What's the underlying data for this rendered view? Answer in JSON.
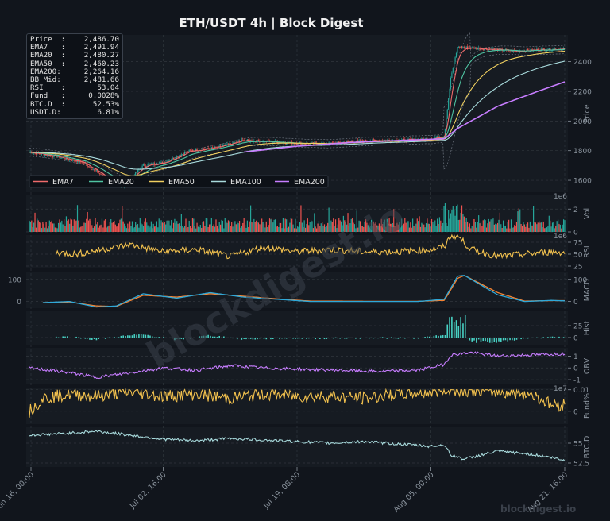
{
  "title": "ETH/USDT  4h  |  Block Digest",
  "watermark_center": "blockdigest.io",
  "watermark_corner": "blockdigest.io",
  "info_box": [
    {
      "label": "Price  :",
      "value": "2,486.70"
    },
    {
      "label": "EMA7   :",
      "value": "2,491.94"
    },
    {
      "label": "EMA20  :",
      "value": "2,480.27"
    },
    {
      "label": "EMA50  :",
      "value": "2,460.23"
    },
    {
      "label": "EMA200:",
      "value": "2,264.16"
    },
    {
      "label": "BB Mid:",
      "value": "2,481.66"
    },
    {
      "label": "RSI    :",
      "value": "53.04"
    },
    {
      "label": "Fund   :",
      "value": "0.0028%"
    },
    {
      "label": "BTC.D  :",
      "value": "52.53%"
    },
    {
      "label": "USDT.D:",
      "value": "6.81%"
    }
  ],
  "colors": {
    "background": "#11151c",
    "candle_up": "#26a69a",
    "candle_down": "#ef5350",
    "ema7": "#ef6b6b",
    "ema20": "#4fc3a1",
    "ema50": "#f0d060",
    "ema100": "#a8dadc",
    "ema200": "#c77dff",
    "rsi": "#f2c14e",
    "macd": "#2fa8d8",
    "signal": "#f58231",
    "hist": "#48d1c4",
    "obv": "#c77dff",
    "funding": "#f2c14e",
    "btcd": "#a8dadc"
  },
  "chart_data": {
    "type": "line",
    "x_ticks": [
      "Jun 16, 00:00",
      "Jul 02, 16:00",
      "Jul 19, 08:00",
      "Aug 05, 00:00",
      "Aug 21, 16:00"
    ],
    "panels": [
      {
        "name": "price",
        "ylabel": "Price",
        "exponent_label": "1e6",
        "ylim": [
          1520,
          2580
        ],
        "yticks": [
          1600,
          1800,
          2000,
          2200,
          2400
        ],
        "legend": [
          "EMA7",
          "EMA20",
          "EMA50",
          "EMA100",
          "EMA200"
        ],
        "legend_position": "lower-left",
        "close_anchors": [
          [
            0,
            1790
          ],
          [
            4,
            1760
          ],
          [
            8,
            1720
          ],
          [
            12,
            1600
          ],
          [
            14,
            1560
          ],
          [
            17,
            1700
          ],
          [
            20,
            1720
          ],
          [
            24,
            1800
          ],
          [
            28,
            1820
          ],
          [
            32,
            1870
          ],
          [
            36,
            1860
          ],
          [
            40,
            1850
          ],
          [
            44,
            1845
          ],
          [
            48,
            1860
          ],
          [
            52,
            1870
          ],
          [
            56,
            1870
          ],
          [
            60,
            1880
          ],
          [
            62,
            1900
          ],
          [
            63,
            2300
          ],
          [
            64,
            2500
          ],
          [
            67,
            2490
          ],
          [
            70,
            2480
          ],
          [
            73,
            2470
          ],
          [
            76,
            2480
          ],
          [
            80,
            2487
          ]
        ],
        "ema200_anchors": [
          [
            32,
            1790
          ],
          [
            40,
            1830
          ],
          [
            48,
            1855
          ],
          [
            56,
            1870
          ],
          [
            62,
            1880
          ],
          [
            64,
            1950
          ],
          [
            70,
            2100
          ],
          [
            76,
            2200
          ],
          [
            80,
            2264
          ]
        ]
      },
      {
        "name": "volume",
        "ylabel": "Vol",
        "exponent_label": "1e6",
        "ylim": [
          0,
          3.2
        ],
        "yticks": [
          0,
          2
        ]
      },
      {
        "name": "rsi",
        "ylabel": "RSI",
        "ylim": [
          20,
          90
        ],
        "yticks": [
          25,
          50,
          75
        ],
        "anchors": [
          [
            0,
            35
          ],
          [
            3,
            55
          ],
          [
            7,
            50
          ],
          [
            11,
            60
          ],
          [
            15,
            70
          ],
          [
            20,
            55
          ],
          [
            25,
            60
          ],
          [
            30,
            45
          ],
          [
            35,
            65
          ],
          [
            40,
            55
          ],
          [
            45,
            60
          ],
          [
            50,
            55
          ],
          [
            55,
            55
          ],
          [
            60,
            60
          ],
          [
            62,
            65
          ],
          [
            63,
            90
          ],
          [
            64,
            88
          ],
          [
            66,
            60
          ],
          [
            70,
            45
          ],
          [
            74,
            50
          ],
          [
            78,
            55
          ],
          [
            80,
            53
          ]
        ]
      },
      {
        "name": "macd",
        "ylabel": "MACD",
        "ylim": [
          -30,
          135
        ],
        "yticks": [
          0,
          100
        ],
        "macd_anchors": [
          [
            2,
            -5
          ],
          [
            6,
            0
          ],
          [
            10,
            -25
          ],
          [
            13,
            -20
          ],
          [
            17,
            35
          ],
          [
            22,
            15
          ],
          [
            27,
            40
          ],
          [
            32,
            20
          ],
          [
            37,
            10
          ],
          [
            42,
            0
          ],
          [
            50,
            0
          ],
          [
            58,
            0
          ],
          [
            62,
            10
          ],
          [
            64,
            115
          ],
          [
            65,
            118
          ],
          [
            70,
            30
          ],
          [
            74,
            0
          ],
          [
            78,
            5
          ],
          [
            80,
            3
          ]
        ],
        "signal_anchors": [
          [
            2,
            -5
          ],
          [
            6,
            -2
          ],
          [
            10,
            -20
          ],
          [
            13,
            -22
          ],
          [
            17,
            28
          ],
          [
            22,
            20
          ],
          [
            27,
            35
          ],
          [
            32,
            24
          ],
          [
            37,
            12
          ],
          [
            42,
            2
          ],
          [
            50,
            1
          ],
          [
            58,
            1
          ],
          [
            62,
            5
          ],
          [
            64,
            105
          ],
          [
            65,
            118
          ],
          [
            70,
            40
          ],
          [
            74,
            2
          ],
          [
            78,
            4
          ],
          [
            80,
            4
          ]
        ]
      },
      {
        "name": "hist",
        "ylabel": "Hist",
        "ylim": [
          -15,
          55
        ],
        "yticks": [
          0,
          25
        ]
      },
      {
        "name": "obv",
        "ylabel": "OBV",
        "exponent_label": "1e7",
        "ylim": [
          -1.4,
          1.7
        ],
        "yticks": [
          -1,
          0,
          1
        ],
        "anchors": [
          [
            0,
            0
          ],
          [
            6,
            -0.4
          ],
          [
            10,
            -0.8
          ],
          [
            14,
            -0.5
          ],
          [
            20,
            0
          ],
          [
            25,
            -0.2
          ],
          [
            30,
            0.2
          ],
          [
            35,
            0
          ],
          [
            40,
            -0.1
          ],
          [
            46,
            -0.2
          ],
          [
            52,
            -0.3
          ],
          [
            58,
            -0.2
          ],
          [
            62,
            0.3
          ],
          [
            63,
            1.1
          ],
          [
            66,
            1.3
          ],
          [
            70,
            1.0
          ],
          [
            75,
            1.1
          ],
          [
            80,
            1.2
          ]
        ]
      },
      {
        "name": "funding",
        "ylabel": "Fund%",
        "ylim": [
          -0.006,
          0.011
        ],
        "yticks": [
          0.0,
          0.01
        ],
        "anchors": [
          [
            0,
            0.0
          ],
          [
            2,
            0.006
          ],
          [
            6,
            0.008
          ],
          [
            10,
            0.007
          ],
          [
            15,
            0.009
          ],
          [
            20,
            0.007
          ],
          [
            25,
            0.008
          ],
          [
            30,
            0.006
          ],
          [
            35,
            0.008
          ],
          [
            40,
            0.007
          ],
          [
            45,
            0.007
          ],
          [
            50,
            0.006
          ],
          [
            55,
            0.008
          ],
          [
            60,
            0.009
          ],
          [
            62,
            0.01
          ],
          [
            64,
            0.01
          ],
          [
            70,
            0.009
          ],
          [
            75,
            0.008
          ],
          [
            78,
            0.003
          ],
          [
            80,
            0.003
          ]
        ]
      },
      {
        "name": "btc_dominance",
        "ylabel": "BTC.D",
        "ylim": [
          52,
          57
        ],
        "yticks": [
          52.5,
          55.0
        ],
        "anchors": [
          [
            0,
            56.0
          ],
          [
            5,
            56.2
          ],
          [
            10,
            56.5
          ],
          [
            15,
            56.0
          ],
          [
            20,
            55.5
          ],
          [
            25,
            55.3
          ],
          [
            30,
            55.6
          ],
          [
            35,
            55.4
          ],
          [
            40,
            55.2
          ],
          [
            45,
            55.0
          ],
          [
            50,
            55.2
          ],
          [
            55,
            54.9
          ],
          [
            60,
            54.6
          ],
          [
            62,
            54.8
          ],
          [
            63,
            53.5
          ],
          [
            65,
            53.0
          ],
          [
            67,
            53.4
          ],
          [
            70,
            54.0
          ],
          [
            75,
            53.6
          ],
          [
            78,
            53.2
          ],
          [
            80,
            52.8
          ]
        ]
      }
    ]
  }
}
